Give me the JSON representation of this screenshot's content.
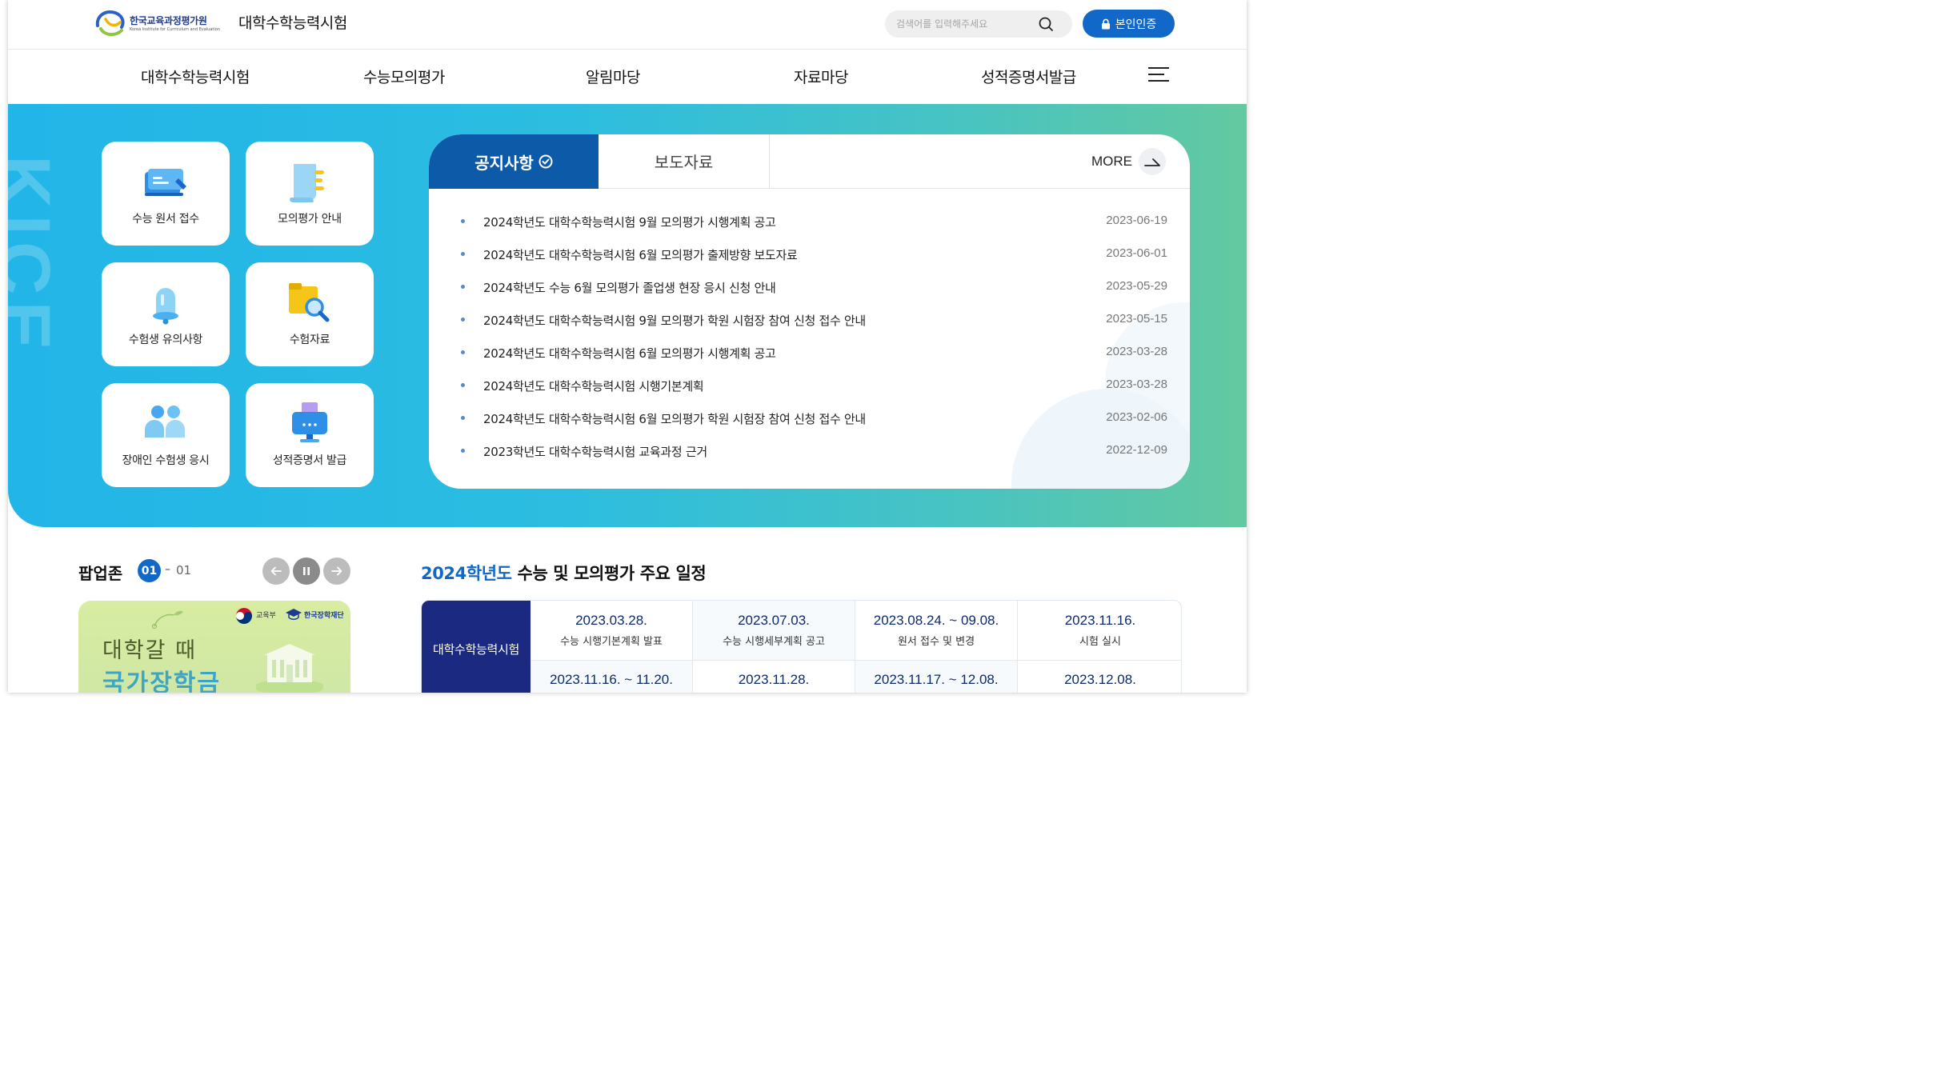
{
  "header": {
    "logo_ko": "한국교육과정평가원",
    "logo_en": "Korea Institute for Curriculum and Evaluation",
    "site_title": "대학수학능력시험",
    "search_placeholder": "검색어를 입력해주세요",
    "auth_label": "본인인증"
  },
  "gnb": {
    "items": [
      "대학수학능력시험",
      "수능모의평가",
      "알림마당",
      "자료마당",
      "성적증명서발급"
    ]
  },
  "hero": {
    "watermark": "KICE",
    "quick_links": [
      {
        "label": "수능 원서 접수",
        "icon": "application-form-icon"
      },
      {
        "label": "모의평가 안내",
        "icon": "document-guide-icon"
      },
      {
        "label": "수험생 유의사항",
        "icon": "alert-bell-icon"
      },
      {
        "label": "수험자료",
        "icon": "folder-search-icon"
      },
      {
        "label": "장애인 수험생 응시",
        "icon": "people-icon"
      },
      {
        "label": "성적증명서 발급",
        "icon": "certificate-print-icon"
      }
    ]
  },
  "board": {
    "tabs": [
      {
        "label": "공지사항",
        "active": true
      },
      {
        "label": "보도자료",
        "active": false
      }
    ],
    "more_label": "MORE",
    "notices": [
      {
        "title": "2024학년도 대학수학능력시험 9월 모의평가 시행계획 공고",
        "date": "2023-06-19"
      },
      {
        "title": "2024학년도 대학수학능력시험 6월 모의평가 출제방향 보도자료",
        "date": "2023-06-01"
      },
      {
        "title": "2024학년도 수능 6월 모의평가 졸업생 현장 응시 신청 안내",
        "date": "2023-05-29"
      },
      {
        "title": "2024학년도 대학수학능력시험 9월 모의평가 학원 시험장 참여 신청 접수 안내",
        "date": "2023-05-15"
      },
      {
        "title": "2024학년도 대학수학능력시험 6월 모의평가 시행계획 공고",
        "date": "2023-03-28"
      },
      {
        "title": "2024학년도 대학수학능력시험 시행기본계획",
        "date": "2023-03-28"
      },
      {
        "title": "2024학년도 대학수학능력시험 6월 모의평가 학원 시험장 참여 신청 접수 안내",
        "date": "2023-02-06"
      },
      {
        "title": "2023학년도 대학수학능력시험 교육과정 근거",
        "date": "2022-12-09"
      }
    ]
  },
  "popup": {
    "title": "팝업존",
    "current": "01",
    "separator": "–",
    "total": "01",
    "banner": {
      "line1": "대학갈 때",
      "line2": "국가장학금",
      "org1": "교육부",
      "org2": "한국장학재단"
    }
  },
  "schedule": {
    "title_highlight": "2024학년도",
    "title_rest": "수능 및 모의평가 주요 일정",
    "row_header": "대학수학능력시험",
    "row1": [
      {
        "date": "2023.03.28.",
        "desc": "수능 시행기본계획 발표"
      },
      {
        "date": "2023.07.03.",
        "desc": "수능 시행세부계획 공고"
      },
      {
        "date": "2023.08.24. ~ 09.08.",
        "desc": "원서 접수 및 변경"
      },
      {
        "date": "2023.11.16.",
        "desc": "시험 실시"
      }
    ],
    "row2": [
      {
        "date": "2023.11.16. ~ 11.20."
      },
      {
        "date": "2023.11.28."
      },
      {
        "date": "2023.11.17. ~ 12.08."
      },
      {
        "date": "2023.12.08."
      }
    ]
  },
  "colors": {
    "primary_blue": "#1268c8",
    "notice_tab": "#0d5ba8",
    "schedule_head": "#1b2a80",
    "hero_gradient_start": "#22b5e8",
    "hero_gradient_end": "#63c9a0"
  }
}
